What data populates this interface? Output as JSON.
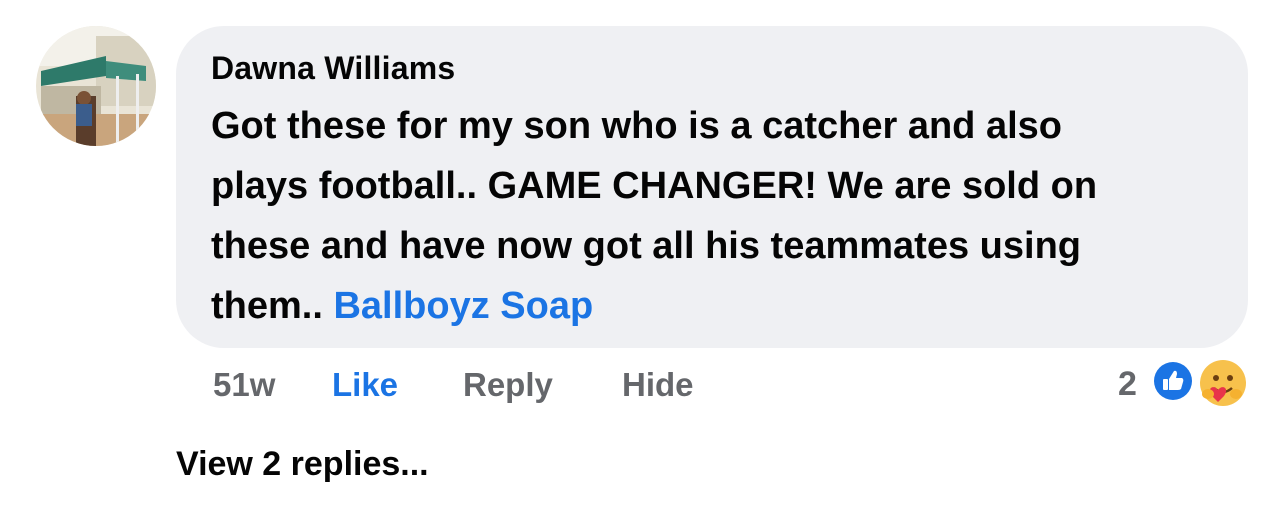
{
  "comment": {
    "author": "Dawna Williams",
    "text": "Got these for my son who is a catcher and also\nplays football.. GAME CHANGER!  We are sold on\nthese and have now got all his teammates using\nthem.. ",
    "tag": "Ballboyz Soap",
    "time": "51w",
    "like_label": "Like",
    "reply_label": "Reply",
    "hide_label": "Hide",
    "reaction_count": "2",
    "reaction_icons": [
      "like-reaction-icon",
      "care-reaction-icon"
    ]
  },
  "view_replies": "View 2 replies...",
  "colors": {
    "bubble": "#eff0f3",
    "link": "#1b74e4",
    "secondary": "#65676b",
    "primary": "#050505"
  }
}
